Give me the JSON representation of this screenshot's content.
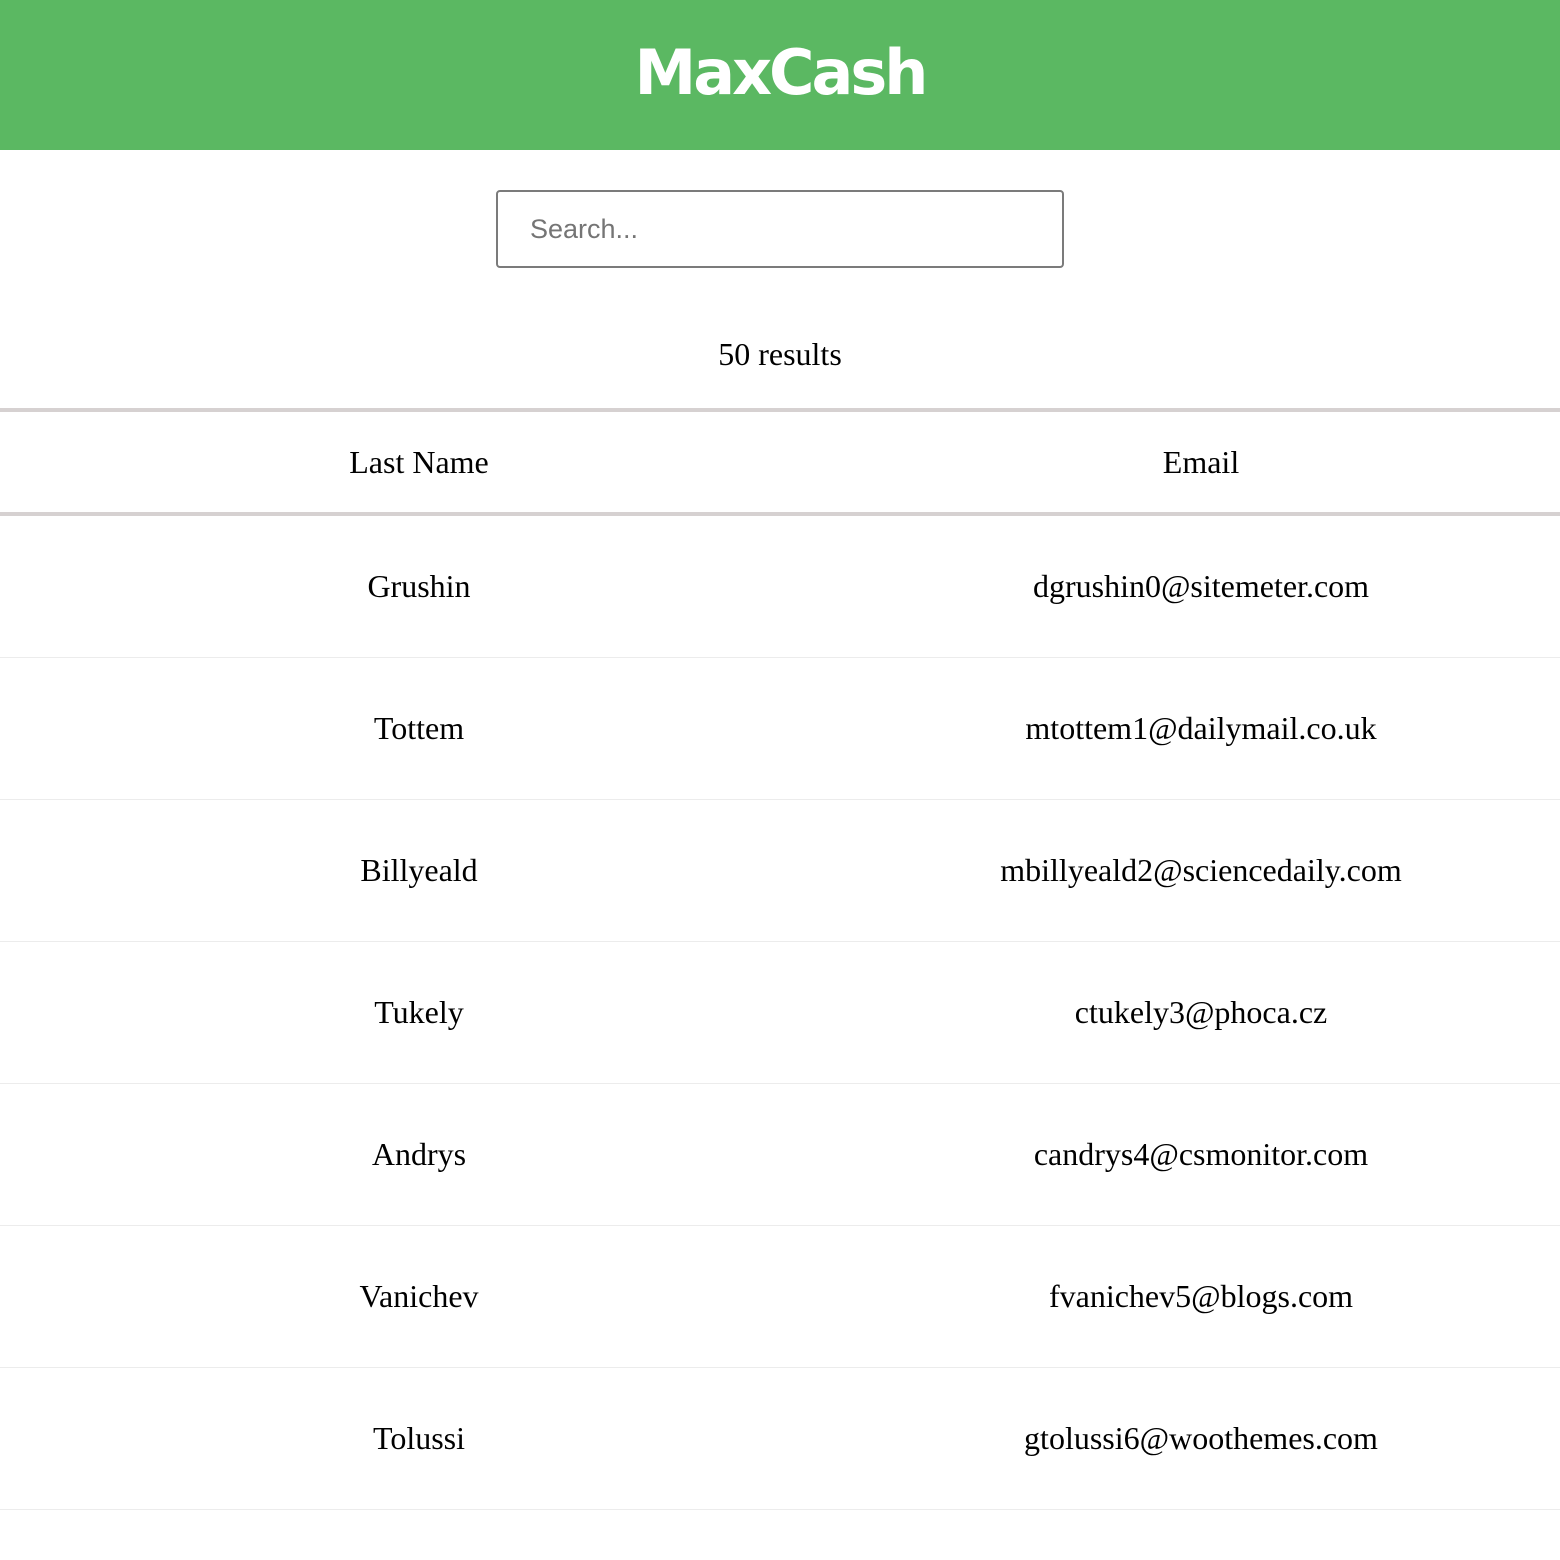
{
  "header": {
    "logo_text": "MaxCash",
    "background_color": "#5bb862"
  },
  "search": {
    "placeholder": "Search...",
    "value": ""
  },
  "results": {
    "count_text": "50 results"
  },
  "table": {
    "columns": [
      "Last Name",
      "Email"
    ],
    "rows": [
      {
        "last_name": "Grushin",
        "email": "dgrushin0@sitemeter.com"
      },
      {
        "last_name": "Tottem",
        "email": "mtottem1@dailymail.co.uk"
      },
      {
        "last_name": "Billyeald",
        "email": "mbillyeald2@sciencedaily.com"
      },
      {
        "last_name": "Tukely",
        "email": "ctukely3@phoca.cz"
      },
      {
        "last_name": "Andrys",
        "email": "candrys4@csmonitor.com"
      },
      {
        "last_name": "Vanichev",
        "email": "fvanichev5@blogs.com"
      },
      {
        "last_name": "Tolussi",
        "email": "gtolussi6@woothemes.com"
      }
    ]
  }
}
